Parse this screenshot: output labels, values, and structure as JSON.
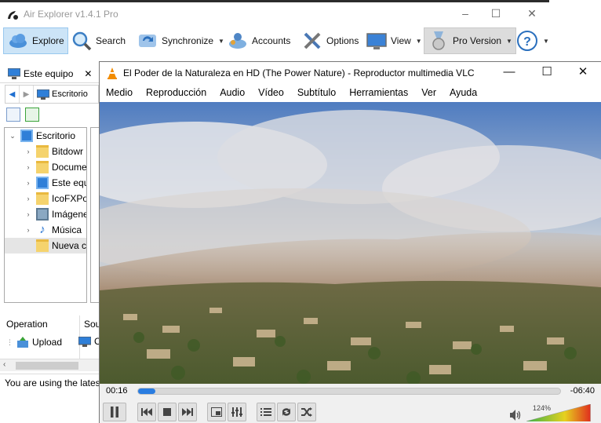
{
  "air_explorer": {
    "title": "Air Explorer v1.4.1 Pro",
    "window_controls": {
      "minimize": "–",
      "maximize": "☐",
      "close": "✕"
    },
    "toolbar": [
      {
        "label": "Explore",
        "icon": "cloud-icon"
      },
      {
        "label": "Search",
        "icon": "magnifier-icon"
      },
      {
        "label": "Synchronize",
        "icon": "sync-icon",
        "dropdown": true
      },
      {
        "label": "Accounts",
        "icon": "accounts-icon"
      },
      {
        "label": "Options",
        "icon": "tools-icon"
      },
      {
        "label": "View",
        "icon": "monitor-icon",
        "dropdown": true
      },
      {
        "label": "Pro Version",
        "icon": "medal-icon",
        "dropdown": true
      },
      {
        "label": "",
        "icon": "help-icon",
        "dropdown": true
      }
    ],
    "tab": {
      "label": "Este equipo",
      "close": "✕"
    },
    "path": "Escritorio",
    "tree": [
      {
        "label": "Escritorio",
        "icon": "pc",
        "expander": "⌄"
      },
      {
        "label": "Bitdowr",
        "icon": "folder",
        "expander": "›"
      },
      {
        "label": "Docume",
        "icon": "folder",
        "expander": "›"
      },
      {
        "label": "Este equ",
        "icon": "pc",
        "expander": "›"
      },
      {
        "label": "IcoFXPo",
        "icon": "folder",
        "expander": "›"
      },
      {
        "label": "Imágene",
        "icon": "img",
        "expander": "›"
      },
      {
        "label": "Música",
        "icon": "music",
        "expander": "›"
      },
      {
        "label": "Nueva c",
        "icon": "folder",
        "expander": "",
        "selected": true
      }
    ],
    "operations": {
      "col1": "Operation",
      "col2": "Sou",
      "row_action": "Upload",
      "row_source": "C"
    },
    "scroll_left": "‹",
    "status": "You are using the latest"
  },
  "vlc": {
    "title": "El Poder de la Naturaleza en HD  (The Power Nature) - Reproductor multimedia VLC",
    "window_controls": {
      "minimize": "—",
      "maximize": "☐",
      "close": "✕"
    },
    "menu": [
      "Medio",
      "Reproducción",
      "Audio",
      "Vídeo",
      "Subtítulo",
      "Herramientas",
      "Ver",
      "Ayuda"
    ],
    "time_elapsed": "00:16",
    "time_remaining": "-06:40",
    "progress": 0.04,
    "volume_label": "124%",
    "volume": 1.24
  }
}
